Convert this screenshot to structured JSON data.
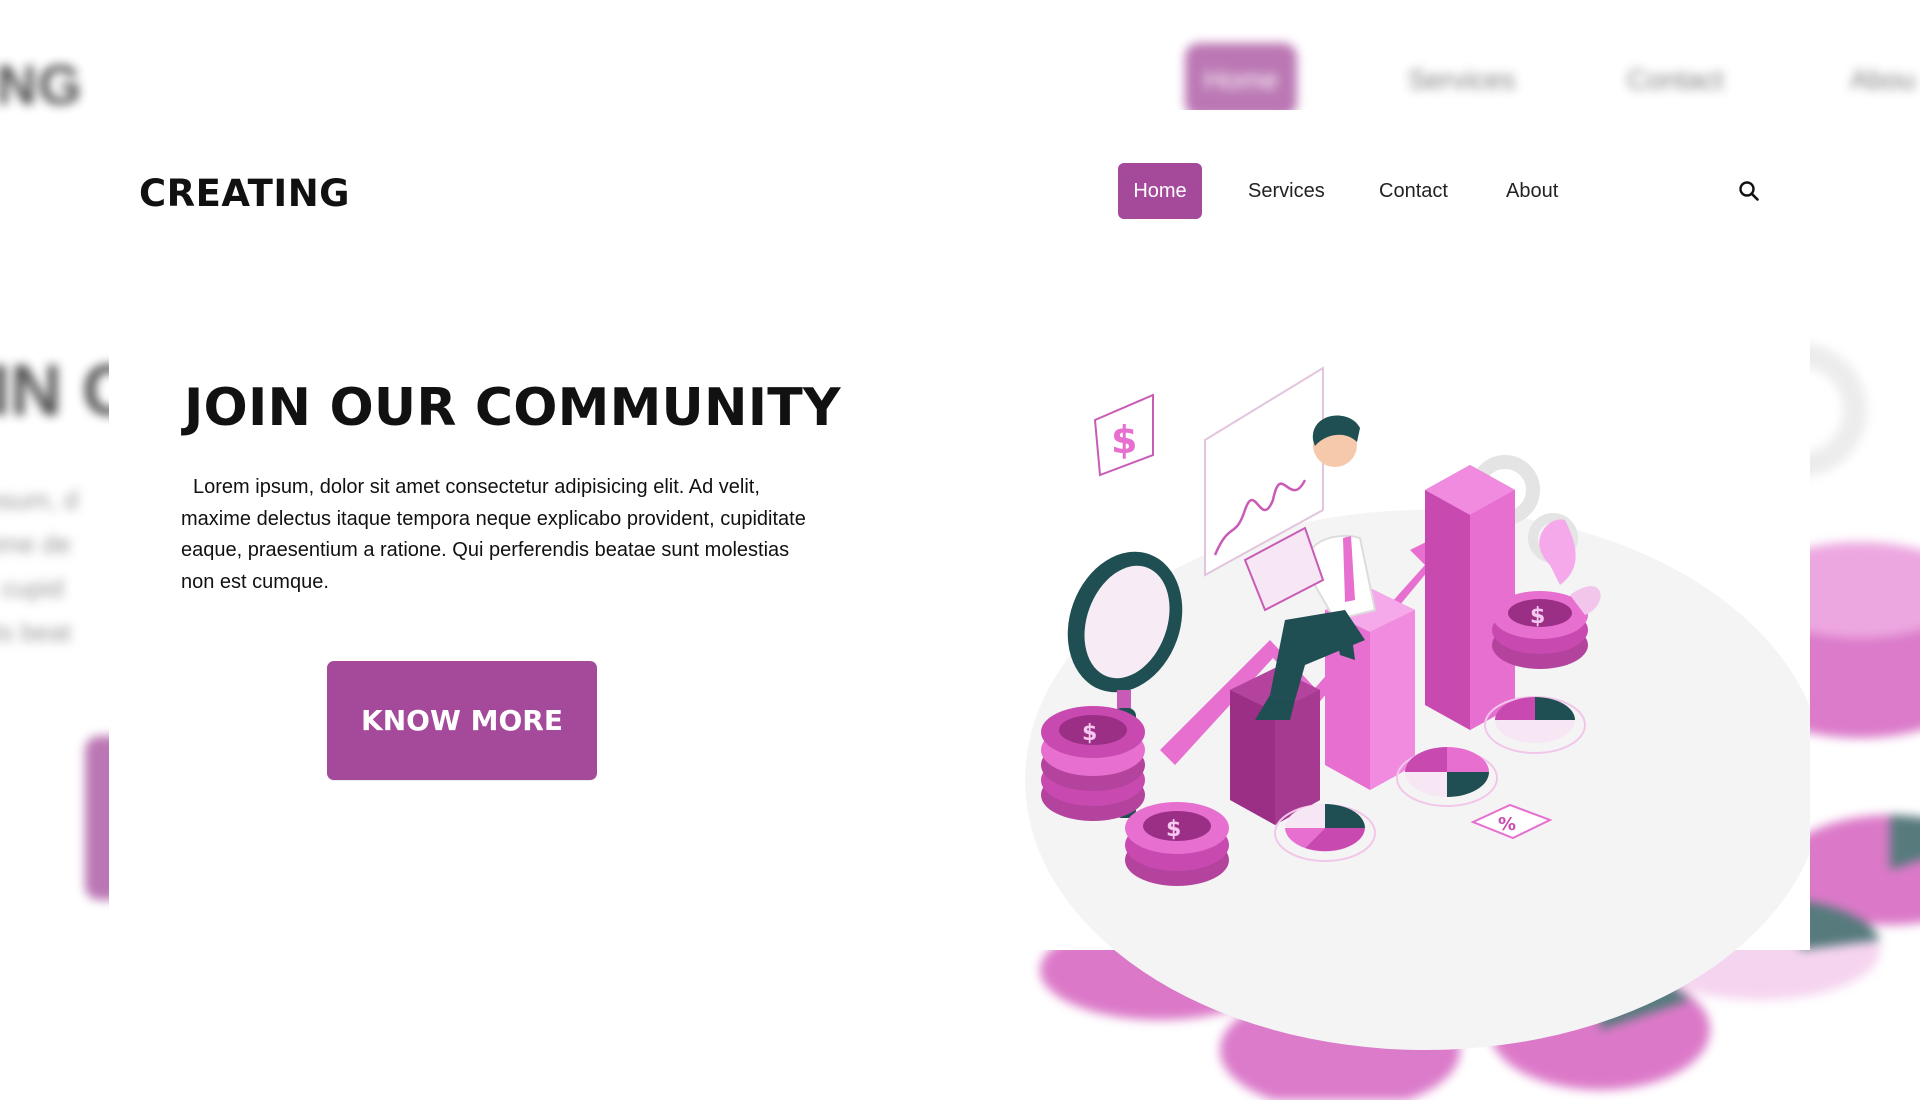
{
  "background": {
    "logo": "ING",
    "nav": {
      "home": "Home",
      "services": "Services",
      "contact": "Contact",
      "about": "Abou"
    },
    "heading": "IN C",
    "para_lines": [
      "ipsum, d",
      "xime de",
      "t, cupid",
      "dis beat"
    ]
  },
  "header": {
    "logo": "CREATING",
    "nav": {
      "home": "Home",
      "services": "Services",
      "contact": "Contact",
      "about": "About"
    },
    "search_icon": "search-icon"
  },
  "hero": {
    "title": "JOIN OUR COMMUNITY",
    "text": "Lorem ipsum, dolor sit amet consectetur adipisicing elit. Ad velit, maxime delectus itaque tempora neque explicabo provident, cupiditate eaque, praesentium a ratione. Qui perferendis beatae sunt molestias non est cumque.",
    "cta_label": "KNOW MORE"
  },
  "illustration": {
    "dollar_sign": "$",
    "percent_sign": "%"
  },
  "colors": {
    "accent": "#a54a9b",
    "pink": "#e66fd0",
    "dark_teal": "#1f4f52",
    "text": "#111111"
  }
}
